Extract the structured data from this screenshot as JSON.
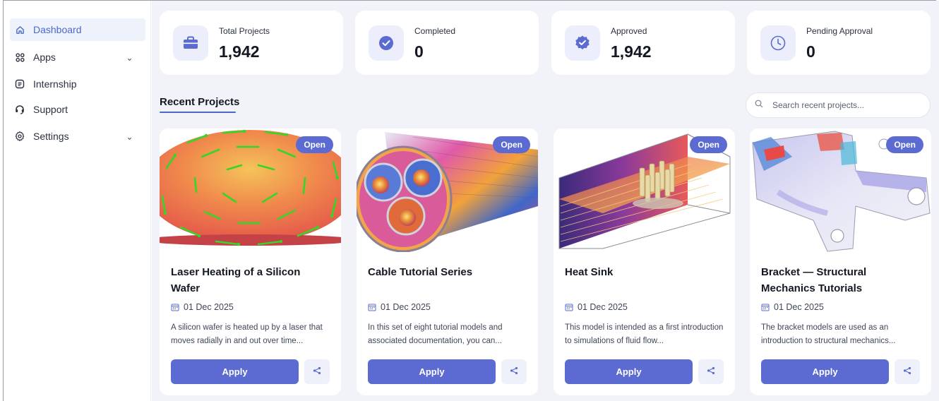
{
  "sidebar": {
    "items": [
      {
        "label": "Dashboard",
        "icon": "home-icon",
        "active": true
      },
      {
        "label": "Apps",
        "icon": "apps-grid-icon",
        "has_chevron": true
      },
      {
        "label": "Internship",
        "icon": "document-icon"
      },
      {
        "label": "Support",
        "icon": "headset-icon"
      },
      {
        "label": "Settings",
        "icon": "gear-icon",
        "has_chevron": true
      }
    ]
  },
  "stats": [
    {
      "label": "Total Projects",
      "value": "1,942",
      "icon": "briefcase-icon"
    },
    {
      "label": "Completed",
      "value": "0",
      "icon": "check-circle-icon"
    },
    {
      "label": "Approved",
      "value": "1,942",
      "icon": "verified-badge-icon"
    },
    {
      "label": "Pending Approval",
      "value": "0",
      "icon": "clock-icon"
    }
  ],
  "recent": {
    "title": "Recent Projects",
    "search_placeholder": "Search recent projects..."
  },
  "projects": [
    {
      "badge": "Open",
      "title": "Laser Heating of a Silicon Wafer",
      "date": "01 Dec 2025",
      "description": "A silicon wafer is heated up by a laser that moves radially in and out over time...",
      "apply_label": "Apply"
    },
    {
      "badge": "Open",
      "title": "Cable Tutorial Series",
      "date": "01 Dec 2025",
      "description": "In this set of eight tutorial models and associated documentation, you can...",
      "apply_label": "Apply"
    },
    {
      "badge": "Open",
      "title": "Heat Sink",
      "date": "01 Dec 2025",
      "description": "This model is intended as a first introduction to simulations of fluid flow...",
      "apply_label": "Apply"
    },
    {
      "badge": "Open",
      "title": "Bracket — Structural Mechanics Tutorials",
      "date": "01 Dec 2025",
      "description": "The bracket models are used as an introduction to structural mechanics...",
      "apply_label": "Apply"
    }
  ],
  "colors": {
    "accent": "#5b6bd1",
    "active_nav_text": "#4c68c9",
    "active_nav_bg": "#eef2fb",
    "main_bg": "#f2f3f8"
  }
}
